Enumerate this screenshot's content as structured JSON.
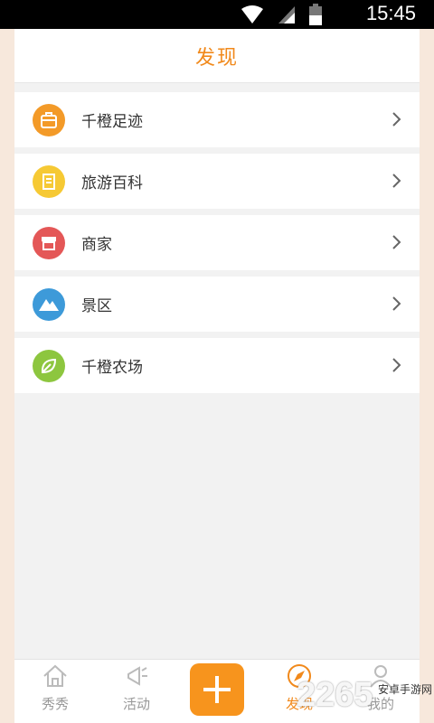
{
  "status_bar": {
    "time": "15:45",
    "icons": [
      "wifi-icon",
      "signal-icon",
      "battery-icon"
    ]
  },
  "header": {
    "title": "发现"
  },
  "menu": {
    "items": [
      {
        "label": "千橙足迹",
        "icon": "suitcase-icon",
        "color": "#f39a28"
      },
      {
        "label": "旅游百科",
        "icon": "document-icon",
        "color": "#f6c934"
      },
      {
        "label": "商家",
        "icon": "storefront-icon",
        "color": "#e45757"
      },
      {
        "label": "景区",
        "icon": "mountain-icon",
        "color": "#3d9ad9"
      },
      {
        "label": "千橙农场",
        "icon": "leaf-icon",
        "color": "#8dc63f"
      }
    ]
  },
  "tabbar": {
    "tabs": [
      {
        "label": "秀秀",
        "icon": "home-icon"
      },
      {
        "label": "活动",
        "icon": "megaphone-icon"
      },
      {
        "label": "",
        "icon": "plus-icon"
      },
      {
        "label": "发现",
        "icon": "discover-icon",
        "active": true
      },
      {
        "label": "我的",
        "icon": "user-icon"
      }
    ],
    "active_color": "#f1891b"
  },
  "watermark": {
    "number": "2265",
    "text": "安卓手游网"
  }
}
